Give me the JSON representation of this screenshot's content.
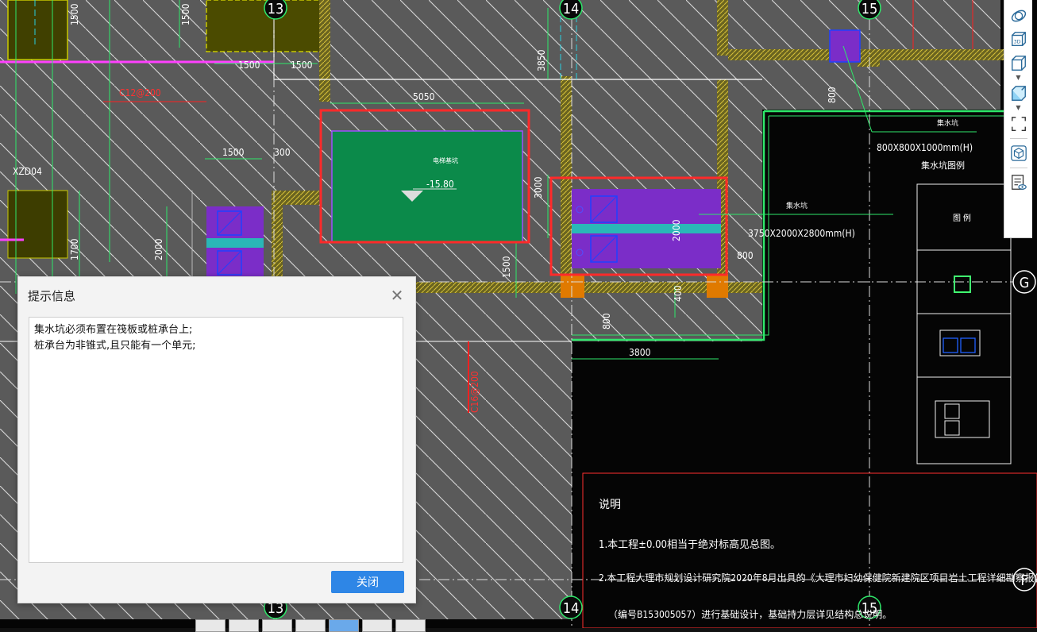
{
  "drawing": {
    "grid_labels": {
      "col_13_top": "13",
      "col_14_top": "14",
      "col_15_top": "15",
      "col_13_bottom": "13",
      "col_14_bottom": "14",
      "col_15_bottom": "15",
      "row_g": "G",
      "row_f": "F"
    },
    "dims": {
      "d1500a": "1500",
      "d1500b": "1500",
      "d1500c": "1500",
      "d1500d": "1500",
      "d1500e": "1500",
      "d5050": "5050",
      "d3850": "3850",
      "d3000": "3000",
      "d2000a": "2000",
      "d2000b": "2000",
      "d1700": "1700",
      "d1500f": "1500",
      "d800a": "800",
      "d800b": "800",
      "d800c": "800",
      "d400": "400",
      "d3800": "3800",
      "d300": "300"
    },
    "labels": {
      "rebar_top": "C12@200",
      "rebar_vertical": "C16@200",
      "xzd": "XZD04",
      "elev": "-15.80",
      "pit_small": "800X800X1000mm(H)",
      "pit_small_title": "集水坑",
      "pit_detail": "集水坑图例",
      "pit_large": "3750X2000X2800mm(H)",
      "pit_large_title": "集水坑",
      "legend_col": "图 例",
      "green_label": "电梯基坑"
    },
    "notes": {
      "heading": "说明",
      "line1": "1.本工程±0.00相当于绝对标高见总图。",
      "line2": "2.本工程大理市规划设计研究院2020年8月出具的《大理市妇幼保健院新建院区项目岩土工程详细勘察报告》",
      "line3": "（编号B153005057）进行基础设计，基础持力层详见结构总说明。"
    }
  },
  "toolbar": {
    "items": [
      "orbit-icon",
      "view-3d-icon",
      "box-view-icon",
      "cube-view-icon",
      "frame-select-icon",
      "model-cube-icon",
      "properties-view-icon"
    ]
  },
  "dialog": {
    "title": "提示信息",
    "line1": "集水坑必须布置在筏板或桩承台上;",
    "line2": "桩承台为非锥式,且只能有一个单元;",
    "close_button": "关闭"
  }
}
